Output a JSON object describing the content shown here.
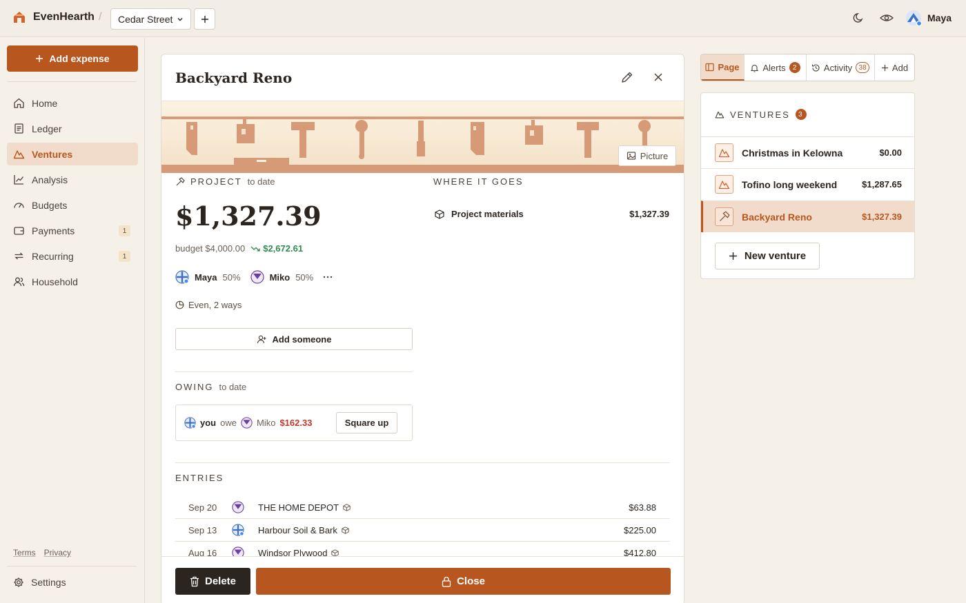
{
  "app": {
    "name": "EvenHearth",
    "workspace": "Cedar Street",
    "user": "Maya"
  },
  "sidebar": {
    "add_expense": "Add expense",
    "items": [
      {
        "label": "Home",
        "icon": "home-icon"
      },
      {
        "label": "Ledger",
        "icon": "ledger-icon"
      },
      {
        "label": "Ventures",
        "icon": "mountain-icon",
        "active": true
      },
      {
        "label": "Analysis",
        "icon": "chart-line-icon"
      },
      {
        "label": "Budgets",
        "icon": "gauge-icon"
      },
      {
        "label": "Payments",
        "icon": "wallet-icon",
        "badge": "1"
      },
      {
        "label": "Recurring",
        "icon": "repeat-icon",
        "badge": "1"
      },
      {
        "label": "Household",
        "icon": "users-icon"
      }
    ],
    "terms": "Terms",
    "privacy": "Privacy",
    "settings": "Settings"
  },
  "venture": {
    "title": "Backyard Reno",
    "picture_label": "Picture",
    "project_label": "PROJECT",
    "project_sub": "to date",
    "total": "$1,327.39",
    "budget": "budget $4,000.00",
    "remaining": "$2,672.61",
    "members": [
      {
        "name": "Maya",
        "pct": "50%"
      },
      {
        "name": "Miko",
        "pct": "50%"
      }
    ],
    "split_method": "Even, 2 ways",
    "add_someone": "Add someone",
    "owing_label": "OWING",
    "owing_sub": "to date",
    "owing": {
      "from": "you",
      "verb": "owe",
      "to": "Miko",
      "amount": "$162.33",
      "action": "Square up"
    },
    "where_label": "WHERE IT GOES",
    "where_items": [
      {
        "label": "Project materials",
        "amount": "$1,327.39"
      }
    ],
    "entries_label": "ENTRIES",
    "entries": [
      {
        "date": "Sep 20",
        "merchant": "THE HOME DEPOT",
        "amount": "$63.88",
        "payer": "Miko"
      },
      {
        "date": "Sep 13",
        "merchant": "Harbour Soil & Bark",
        "amount": "$225.00",
        "payer": "Maya"
      },
      {
        "date": "Aug 16",
        "merchant": "Windsor Plywood",
        "amount": "$412.80",
        "payer": "Miko"
      }
    ],
    "delete": "Delete",
    "close": "Close"
  },
  "right": {
    "tabs": [
      {
        "label": "Page"
      },
      {
        "label": "Alerts",
        "count": "2"
      },
      {
        "label": "Activity",
        "count": "38"
      },
      {
        "label": "Add"
      }
    ],
    "ventures_label": "VENTURES",
    "ventures_count": "3",
    "ventures": [
      {
        "name": "Christmas in Kelowna",
        "amount": "$0.00",
        "icon": "mountain-icon"
      },
      {
        "name": "Tofino long weekend",
        "amount": "$1,287.65",
        "icon": "mountain-icon"
      },
      {
        "name": "Backyard Reno",
        "amount": "$1,327.39",
        "icon": "hammer-icon",
        "active": true
      }
    ],
    "new_venture": "New venture"
  },
  "colors": {
    "accent": "#b8561f",
    "positive": "#2f8a4e",
    "negative": "#c0392b",
    "dark": "#2b241f"
  }
}
